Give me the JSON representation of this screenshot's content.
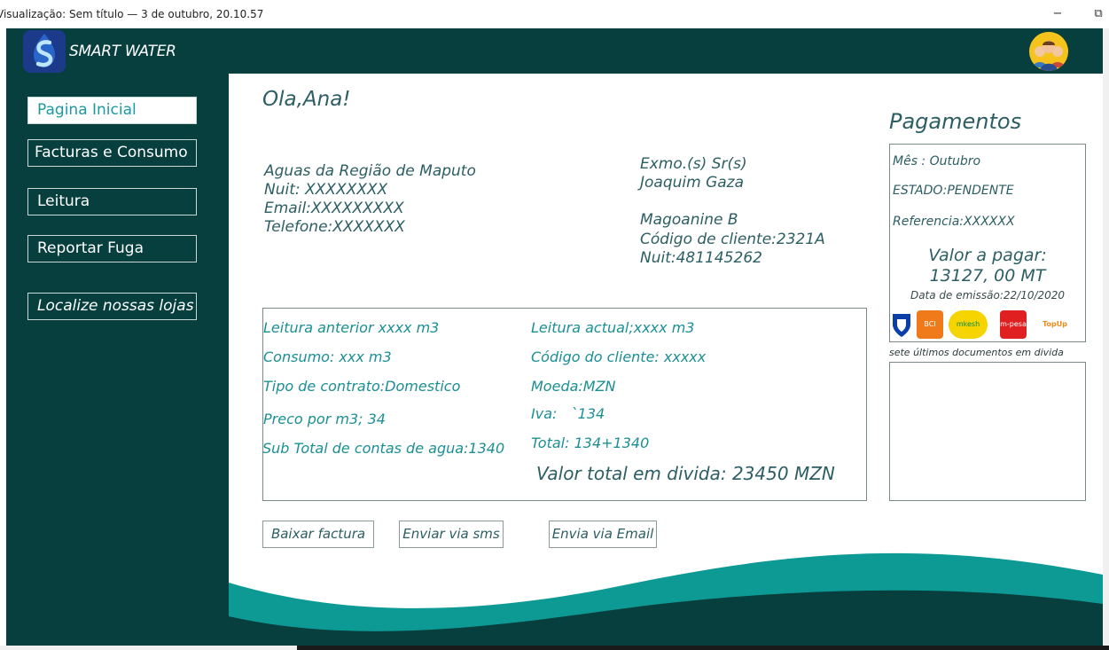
{
  "window": {
    "title": "Visualização: Sem título — 3 de outubro, 20.10.57",
    "minimize_glyph": "−",
    "restore_glyph": "⧉"
  },
  "header": {
    "brand": "SMART WATER",
    "logo_icon": "water-drop-s-icon",
    "avatar_icon": "user-group-avatar-icon"
  },
  "sidebar": {
    "items": [
      {
        "label": "Pagina Inicial",
        "active": true
      },
      {
        "label": "Facturas e Consumo"
      },
      {
        "label": "Leitura"
      },
      {
        "label": "Reportar Fuga"
      },
      {
        "label": "Localize nossas lojas"
      }
    ]
  },
  "main": {
    "greeting": "Ola,Ana!",
    "company": {
      "name": "Aguas da Região de Maputo",
      "nuit": "Nuit: XXXXXXXX",
      "email": "Email:XXXXXXXXX",
      "phone": "Telefone:XXXXXXX"
    },
    "client": {
      "salutation": "Exmo.(s) Sr(s)",
      "name": "Joaquim Gaza",
      "address": "Magoanine B",
      "code": "Código de cliente:2321A",
      "nuit": "Nuit:481145262"
    },
    "details": {
      "left": [
        "Leitura anterior xxxx m3",
        "Consumo: xxx m3",
        "Tipo de contrato:Domestico",
        "Preco por m3; 34",
        "Sub Total de contas de agua:1340"
      ],
      "right": [
        "Leitura  actual;xxxx m3",
        "Código do cliente: xxxxx",
        "Moeda:MZN",
        "Iva:   `134",
        "Total: 134+1340"
      ],
      "total_debt": "Valor total em divida: 23450 MZN"
    },
    "buttons": {
      "download": "Baixar factura",
      "sms": "Enviar via sms",
      "email": "Envia via Email"
    }
  },
  "payments": {
    "title": "Pagamentos",
    "month": "Mês : Outubro",
    "status": "ESTADO:PENDENTE",
    "reference": "Referencia:XXXXXX",
    "amount_label": "Valor a pagar:",
    "amount": "13127, 00 MT",
    "issue_date": "Data de emissão:22/10/2020",
    "providers": [
      {
        "name": "standard-bank-icon"
      },
      {
        "name": "bci-icon",
        "label": "BCI"
      },
      {
        "name": "mkesh-icon",
        "label": "mkesh"
      },
      {
        "name": "mpesa-icon",
        "label": "m-pesa"
      },
      {
        "name": "topup-icon",
        "label": "TopUp"
      }
    ],
    "documents_label": "sete últimos documentos em divida"
  },
  "colors": {
    "sidebar_bg": "#073f3f",
    "accent_teal": "#1b8f94",
    "dark_text": "#2c5e63",
    "wave_teal": "#0e9a94"
  }
}
